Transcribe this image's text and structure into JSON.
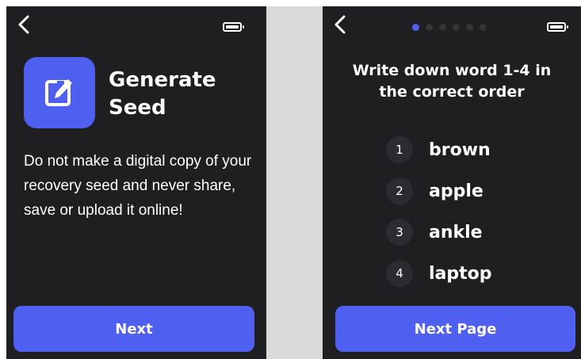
{
  "left_screen": {
    "title": "Generate Seed",
    "body": "Do not make a digital copy of your recovery seed and never share, save or upload it online!",
    "button_label": "Next",
    "icon": "pencil-edit-icon",
    "back_icon": "chevron-left-icon",
    "battery_icon": "battery-icon"
  },
  "right_screen": {
    "title": "Write down word 1-4 in the correct order",
    "pager": {
      "total": 6,
      "active_index": 0
    },
    "words": [
      {
        "number": "1",
        "word": "brown"
      },
      {
        "number": "2",
        "word": "apple"
      },
      {
        "number": "3",
        "word": "ankle"
      },
      {
        "number": "4",
        "word": "laptop"
      }
    ],
    "button_label": "Next Page",
    "back_icon": "chevron-left-icon",
    "battery_icon": "battery-icon"
  },
  "colors": {
    "background": "#1f1f22",
    "accent": "#4f5ff0",
    "text": "#ffffff",
    "number_badge": "#2c2c30",
    "divider": "#d9d9d9"
  }
}
